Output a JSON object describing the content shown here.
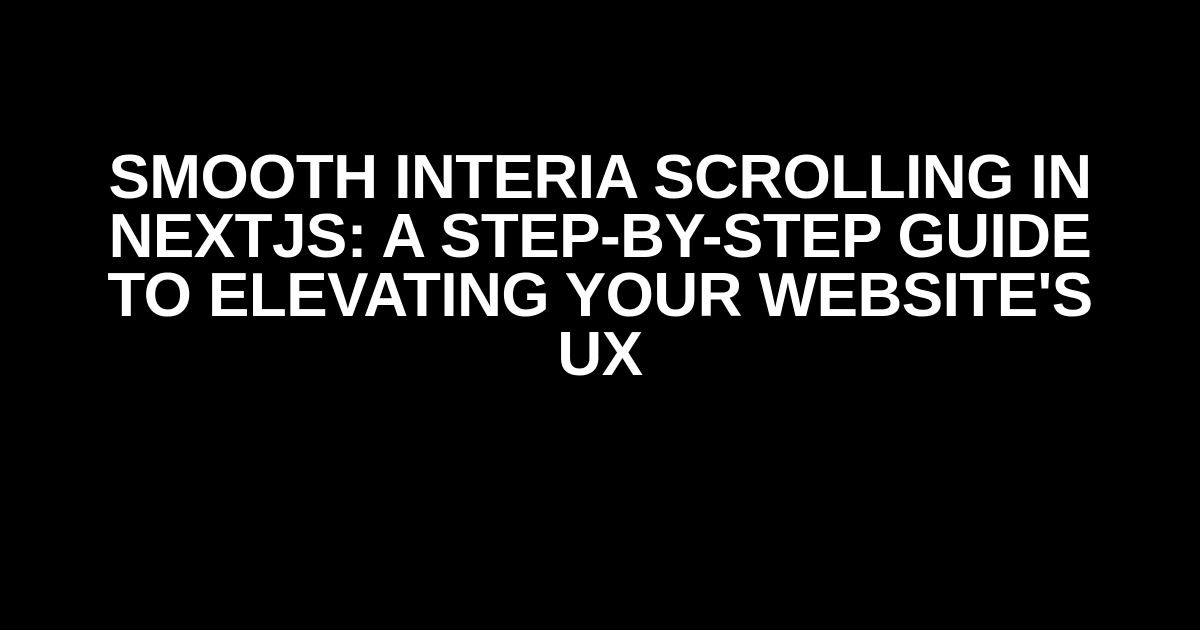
{
  "title": "Smooth Interia Scrolling in NextJS: A Step-by-Step Guide to Elevating Your Website's UX"
}
